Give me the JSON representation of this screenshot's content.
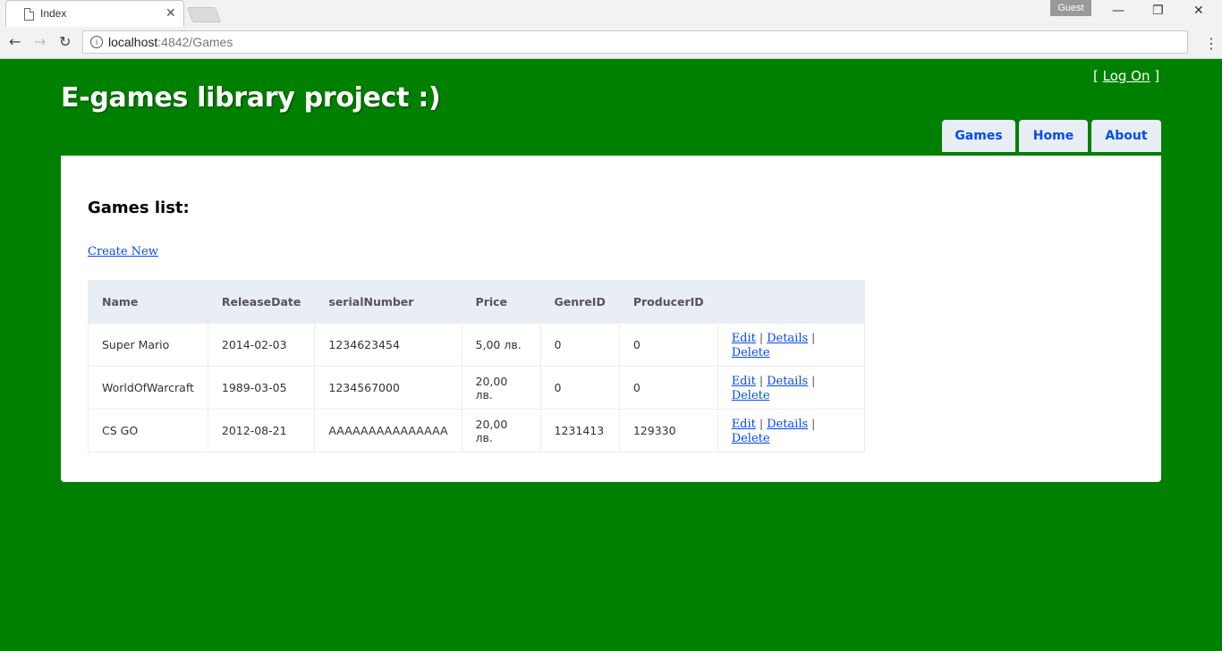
{
  "browser": {
    "tab_title": "Index",
    "tab_close": "✕",
    "profile": "Guest",
    "url_host": "localhost",
    "url_path": ":4842/Games",
    "info_glyph": "i",
    "window_controls": {
      "minimize": "—",
      "restore": "❐",
      "close": "✕"
    },
    "nav": {
      "back": "←",
      "forward": "→",
      "reload": "↻",
      "menu": "⋮"
    }
  },
  "header": {
    "title": "E-games library project :)",
    "login_prefix": "[ ",
    "login_link": "Log On",
    "login_suffix": " ]"
  },
  "menu": [
    {
      "label": "Games"
    },
    {
      "label": "Home"
    },
    {
      "label": "About"
    }
  ],
  "main": {
    "heading": "Games list:",
    "create_link": "Create New"
  },
  "table": {
    "headers": [
      "Name",
      "ReleaseDate",
      "serialNumber",
      "Price",
      "GenreID",
      "ProducerID",
      ""
    ],
    "rows": [
      [
        "Super Mario",
        "2014-02-03",
        "1234623454",
        "5,00 лв.",
        "0",
        "0"
      ],
      [
        "WorldOfWarcraft",
        "1989-03-05",
        "1234567000",
        "20,00 лв.",
        "0",
        "0"
      ],
      [
        "CS GO",
        "2012-08-21",
        "AAAAAAAAAAAAAAA",
        "20,00 лв.",
        "1231413",
        "129330"
      ]
    ],
    "actions": {
      "edit": "Edit",
      "details": "Details",
      "delete": "Delete",
      "separator": "|"
    }
  },
  "colors": {
    "page_bg": "#008000",
    "link": "#034af3",
    "menu_bg": "#e8eef4"
  }
}
